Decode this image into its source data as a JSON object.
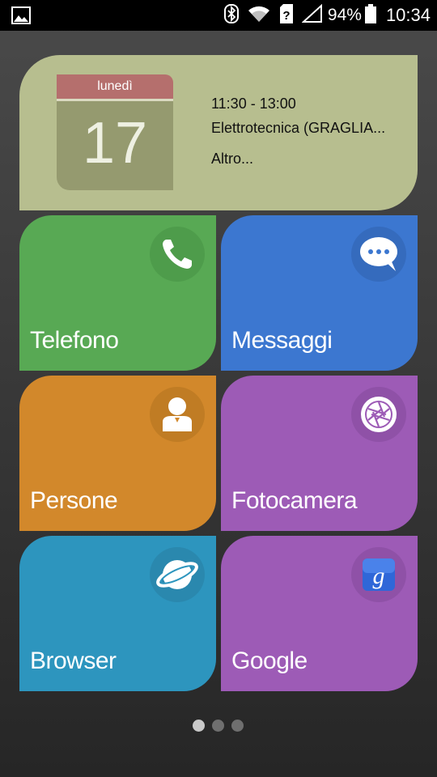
{
  "status_bar": {
    "battery_percent": "94%",
    "time": "10:34",
    "icons": [
      "gallery-icon",
      "bluetooth-icon",
      "wifi-icon",
      "no-sim-icon",
      "signal-icon",
      "battery-icon"
    ]
  },
  "calendar_widget": {
    "day_name": "lunedì",
    "day_number": "17",
    "event_time": "11:30 - 13:00",
    "event_title": "Elettrotecnica (GRAGLIA...",
    "more_label": "Altro..."
  },
  "tiles": [
    {
      "label": "Telefono",
      "icon": "phone-icon",
      "color": "#58a954"
    },
    {
      "label": "Messaggi",
      "icon": "message-icon",
      "color": "#3c77d0"
    },
    {
      "label": "Persone",
      "icon": "person-icon",
      "color": "#d2882b"
    },
    {
      "label": "Fotocamera",
      "icon": "camera-shutter-icon",
      "color": "#9d5bb6"
    },
    {
      "label": "Browser",
      "icon": "browser-globe-icon",
      "color": "#2d95be"
    },
    {
      "label": "Google",
      "icon": "google-icon",
      "color": "#9d5bb6"
    }
  ],
  "pager": {
    "pages": 3,
    "current": 1
  }
}
